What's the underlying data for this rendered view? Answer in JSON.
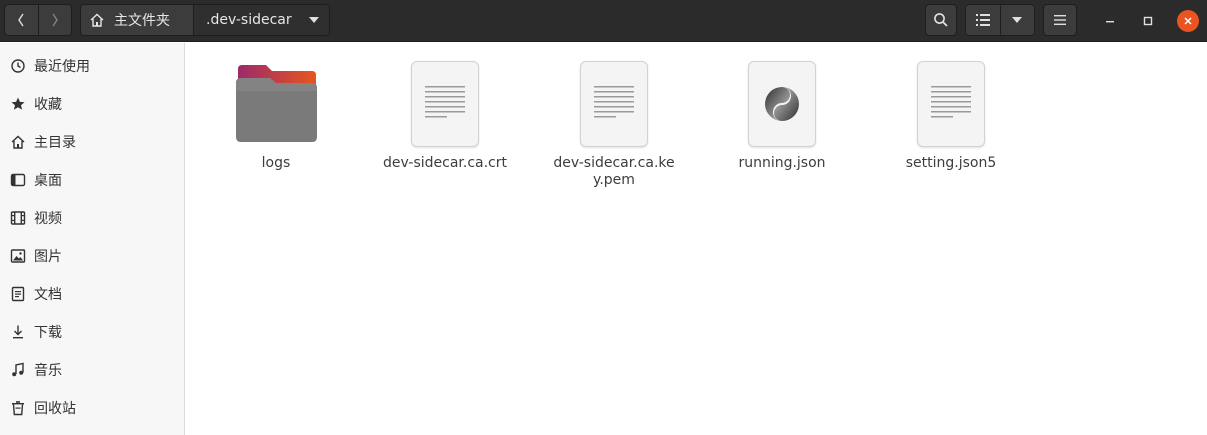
{
  "header": {
    "back_icon": "chevron-left-icon",
    "forward_icon": "chevron-right-icon",
    "breadcrumb": {
      "home_label": "主文件夹",
      "current_label": ".dev-sidecar"
    },
    "search_icon": "search-icon",
    "view_icon": "list-view-icon",
    "menu_icon": "hamburger-menu-icon",
    "window_controls": [
      "minimize-icon",
      "maximize-icon",
      "close-icon"
    ],
    "accent_close": "#e95420"
  },
  "sidebar": {
    "items": [
      {
        "label": "最近使用",
        "icon": "recent-icon"
      },
      {
        "label": "收藏",
        "icon": "star-icon"
      },
      {
        "label": "主目录",
        "icon": "home-icon"
      },
      {
        "label": "桌面",
        "icon": "desktop-icon"
      },
      {
        "label": "视频",
        "icon": "video-icon"
      },
      {
        "label": "图片",
        "icon": "picture-icon"
      },
      {
        "label": "文档",
        "icon": "document-icon"
      },
      {
        "label": "下载",
        "icon": "download-icon"
      },
      {
        "label": "音乐",
        "icon": "music-icon"
      },
      {
        "label": "回收站",
        "icon": "trash-icon"
      }
    ]
  },
  "files": [
    {
      "name": "logs",
      "icon": "folder-icon"
    },
    {
      "name": "dev-sidecar.ca.crt",
      "icon": "text-file-icon"
    },
    {
      "name": "dev-sidecar.ca.key.pem",
      "icon": "text-file-icon"
    },
    {
      "name": "running.json",
      "icon": "json-file-icon"
    },
    {
      "name": "setting.json5",
      "icon": "text-file-icon"
    }
  ]
}
